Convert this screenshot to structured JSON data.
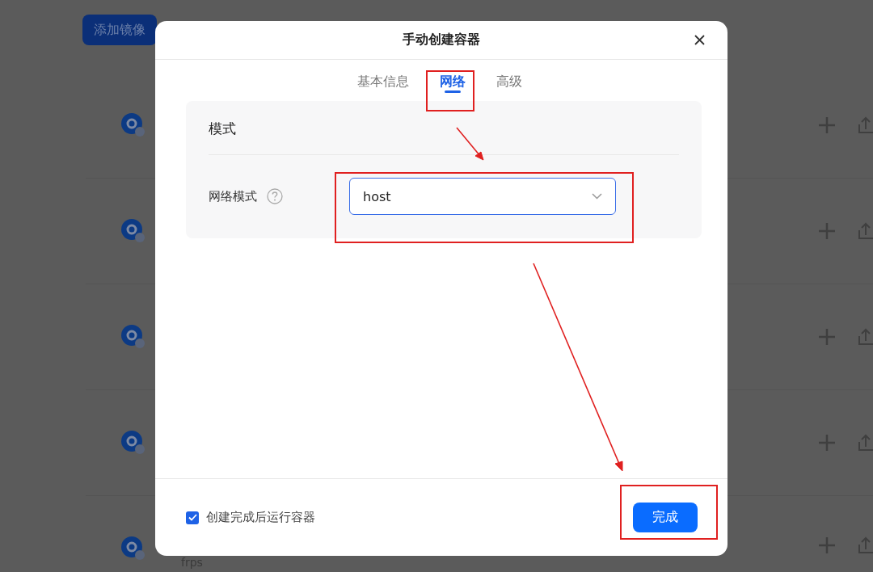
{
  "page": {
    "add_button": "添加镜像",
    "images": [
      {
        "kind": "image"
      },
      {
        "kind": "image"
      },
      {
        "kind": "image"
      },
      {
        "kind": "image"
      },
      {
        "kind": "image",
        "name": "frps"
      }
    ]
  },
  "dialog": {
    "title": "手动创建容器",
    "tabs": [
      {
        "label": "基本信息",
        "selected": false
      },
      {
        "label": "网络",
        "selected": true
      },
      {
        "label": "高级",
        "selected": false
      }
    ],
    "section": {
      "title": "模式",
      "field_label": "网络模式",
      "select_value": "host"
    },
    "run_after_create": {
      "label": "创建完成后运行容器",
      "checked": true
    },
    "done_button": "完成"
  }
}
